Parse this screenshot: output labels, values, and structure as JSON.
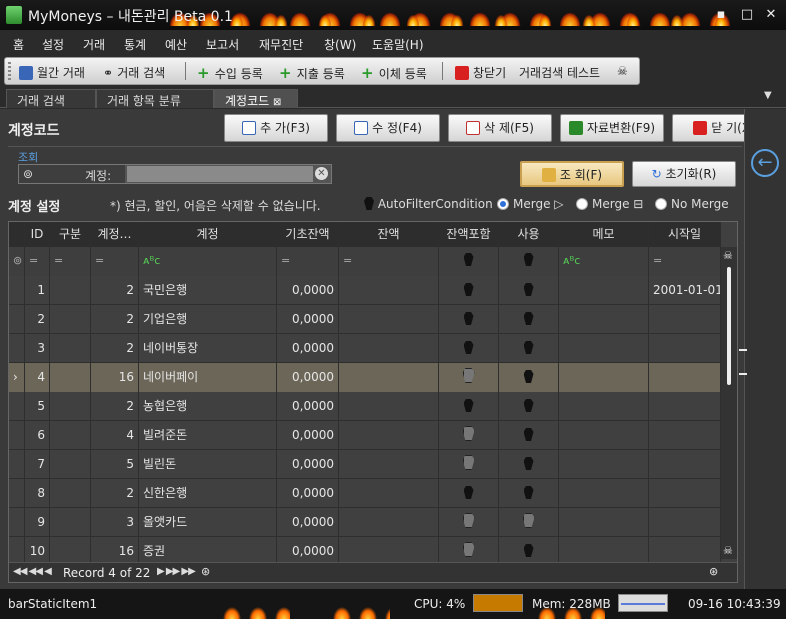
{
  "window": {
    "title": "MyMoneys – 내돈관리 Beta 0.1",
    "buttons": [
      "▪",
      "□",
      "✕"
    ]
  },
  "menu": [
    "홈",
    "설정",
    "거래",
    "통계",
    "예산",
    "보고서",
    "재무진단",
    "창(W)",
    "도움말(H)"
  ],
  "toolbar": {
    "items": [
      "월간 거래",
      "거래 검색",
      "수입 등록",
      "지출 등록",
      "이체 등록",
      "창닫기",
      "거래검색 테스트"
    ]
  },
  "tabs": [
    "거래 검색",
    "거래 항목 분류",
    "계정코드"
  ],
  "page": {
    "title": "계정코드",
    "buttons": {
      "add": "추 가(F3)",
      "edit": "수 정(F4)",
      "delete": "삭 제(F5)",
      "convert": "자료변환(F9)",
      "close": "닫 기(X)"
    }
  },
  "search": {
    "group_label": "조회",
    "field_caption": "계정:",
    "field_value": "",
    "query_button": "조 회(F)",
    "reset_button": "초기화(R)"
  },
  "settings": {
    "title": "계정 설정",
    "note": "*) 현금, 할인, 어음은 삭제할 수 없습니다.",
    "filter_option": "AutoFilterCondition",
    "merge_options": [
      "Merge ▷",
      "Merge ⊟",
      "No Merge"
    ],
    "merge_selected": 0
  },
  "grid": {
    "columns": [
      "ID",
      "구분",
      "계정…",
      "계정",
      "기초잔액",
      "잔액",
      "잔액포함",
      "사용",
      "메모",
      "시작일"
    ],
    "filter_row": [
      "=",
      "=",
      "=",
      "ᴀᴮc",
      "=",
      "=",
      "",
      "",
      "ᴀᴮc",
      "="
    ],
    "rows": [
      {
        "id": "1",
        "type": "",
        "code": "2",
        "name": "국민은행",
        "opening": "0,0000",
        "balance": "",
        "include": true,
        "use": true,
        "memo": "",
        "start": "2001-01-01"
      },
      {
        "id": "2",
        "type": "",
        "code": "2",
        "name": "기업은행",
        "opening": "0,0000",
        "balance": "",
        "include": true,
        "use": true,
        "memo": "",
        "start": ""
      },
      {
        "id": "3",
        "type": "",
        "code": "2",
        "name": "네이버통장",
        "opening": "0,0000",
        "balance": "",
        "include": true,
        "use": true,
        "memo": "",
        "start": ""
      },
      {
        "id": "4",
        "type": "",
        "code": "16",
        "name": "네이버페이",
        "opening": "0,0000",
        "balance": "",
        "include": false,
        "use": true,
        "memo": "",
        "start": ""
      },
      {
        "id": "5",
        "type": "",
        "code": "2",
        "name": "농협은행",
        "opening": "0,0000",
        "balance": "",
        "include": true,
        "use": true,
        "memo": "",
        "start": ""
      },
      {
        "id": "6",
        "type": "",
        "code": "4",
        "name": "빌려준돈",
        "opening": "0,0000",
        "balance": "",
        "include": false,
        "use": true,
        "memo": "",
        "start": ""
      },
      {
        "id": "7",
        "type": "",
        "code": "5",
        "name": "빌린돈",
        "opening": "0,0000",
        "balance": "",
        "include": false,
        "use": true,
        "memo": "",
        "start": ""
      },
      {
        "id": "8",
        "type": "",
        "code": "2",
        "name": "신한은행",
        "opening": "0,0000",
        "balance": "",
        "include": true,
        "use": true,
        "memo": "",
        "start": ""
      },
      {
        "id": "9",
        "type": "",
        "code": "3",
        "name": "올앳카드",
        "opening": "0,0000",
        "balance": "",
        "include": false,
        "use": false,
        "memo": "",
        "start": ""
      },
      {
        "id": "10",
        "type": "",
        "code": "16",
        "name": "증권",
        "opening": "0,0000",
        "balance": "",
        "include": false,
        "use": true,
        "memo": "",
        "start": ""
      }
    ],
    "selected_row": 3,
    "record_text": "Record 4 of 22"
  },
  "status": {
    "item": "barStaticItem1",
    "cpu": "CPU: 4%",
    "mem": "Mem: 228MB",
    "time": "09-16 10:43:39"
  },
  "colors": {
    "accent": "#5aa0e0",
    "selected_row": "#6b6658",
    "panel": "#3a3a3a"
  }
}
